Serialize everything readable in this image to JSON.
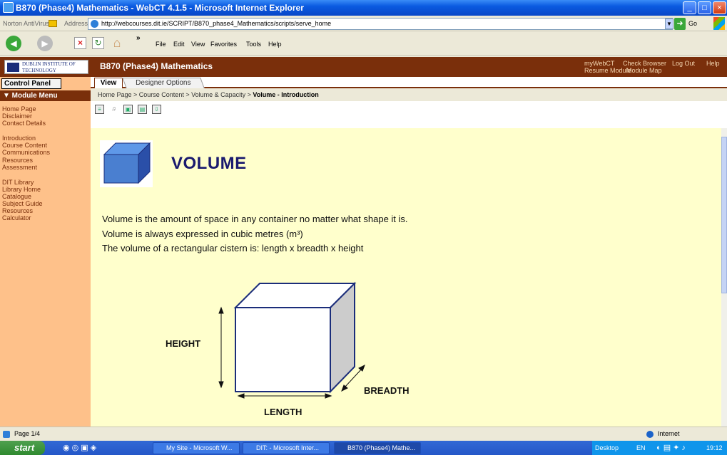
{
  "window": {
    "title": "B870 (Phase4) Mathematics - WebCT 4.1.5 - Microsoft Internet Explorer",
    "controls": [
      "_",
      "□",
      "×"
    ]
  },
  "addressbar": {
    "norton": "Norton AntiVirus",
    "label": "Address",
    "url": "http://webcourses.dit.ie/SCRIPT/B870_phase4_Mathematics/scripts/serve_home",
    "go": "Go"
  },
  "menu": [
    "File",
    "Edit",
    "View",
    "Favorites",
    "Tools",
    "Help"
  ],
  "header": {
    "logo_text": "DUBLIN INSTITUTE OF TECHNOLOGY",
    "course_title": "B870 (Phase4) Mathematics",
    "links_row1": [
      "myWebCT",
      "Check Browser",
      "Log Out",
      "Help"
    ],
    "links_row2": [
      "Resume Module",
      "Module Map"
    ]
  },
  "sidebar": {
    "control_panel": "Control Panel",
    "module_menu": "▼ Module Menu",
    "group1": [
      "Home Page",
      "Disclaimer",
      "Contact Details"
    ],
    "group2": [
      "Introduction",
      "Course Content",
      "Communications",
      "Resources",
      "Assessment"
    ],
    "group3": [
      "DIT Library",
      "Library Home",
      "Catalogue",
      "Subject Guide",
      "Resources",
      "Calculator"
    ]
  },
  "tabs": {
    "view": "View",
    "designer": "Designer Options"
  },
  "breadcrumb": {
    "path": "Home Page > Course Content > Volume & Capacity > ",
    "current": "Volume - Introduction"
  },
  "content": {
    "heading": "VOLUME",
    "paragraphs": [
      "Volume is the amount of space in any container no matter what shape it is.",
      "Volume is always expressed in cubic metres (m³)",
      "The volume of a rectangular cistern is: length x breadth x height"
    ],
    "diagram": {
      "height": "HEIGHT",
      "breadth": "BREADTH",
      "length": "LENGTH"
    }
  },
  "status": {
    "page": "Page 1/4",
    "zone": "Internet"
  },
  "taskbar": {
    "start": "start",
    "tasks": [
      "My Site - Microsoft W...",
      "DIT: - Microsoft Inter...",
      "B870 (Phase4) Mathe..."
    ],
    "desktop": "Desktop",
    "lang": "EN",
    "clock": "19:12"
  }
}
